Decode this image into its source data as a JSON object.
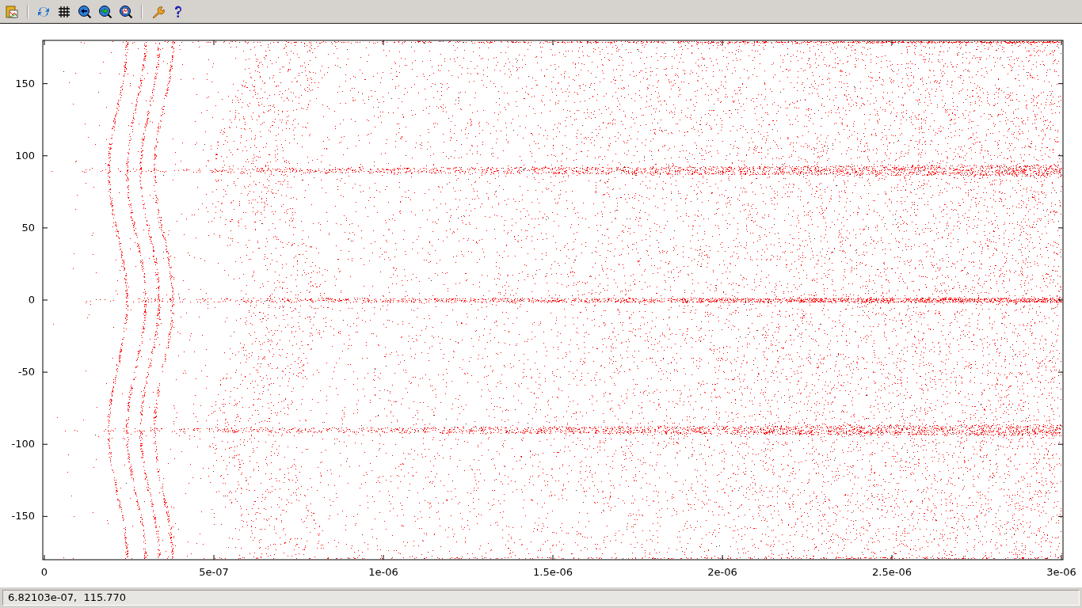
{
  "plot": {
    "chart_data": {
      "type": "scatter",
      "xlim": [
        0,
        3e-06
      ],
      "ylim": [
        -180,
        180
      ],
      "xticks": [
        {
          "value": 0,
          "label": "0"
        },
        {
          "value": 5e-07,
          "label": "5e-07"
        },
        {
          "value": 1e-06,
          "label": "1e-06"
        },
        {
          "value": 1.5e-06,
          "label": "1.5e-06"
        },
        {
          "value": 2e-06,
          "label": "2e-06"
        },
        {
          "value": 2.5e-06,
          "label": "2.5e-06"
        },
        {
          "value": 3e-06,
          "label": "3e-06"
        }
      ],
      "yticks": [
        -150,
        -100,
        -50,
        0,
        50,
        100,
        150
      ]
    }
  },
  "status_bar": {
    "text": "6.82103e-07,  115.770"
  }
}
